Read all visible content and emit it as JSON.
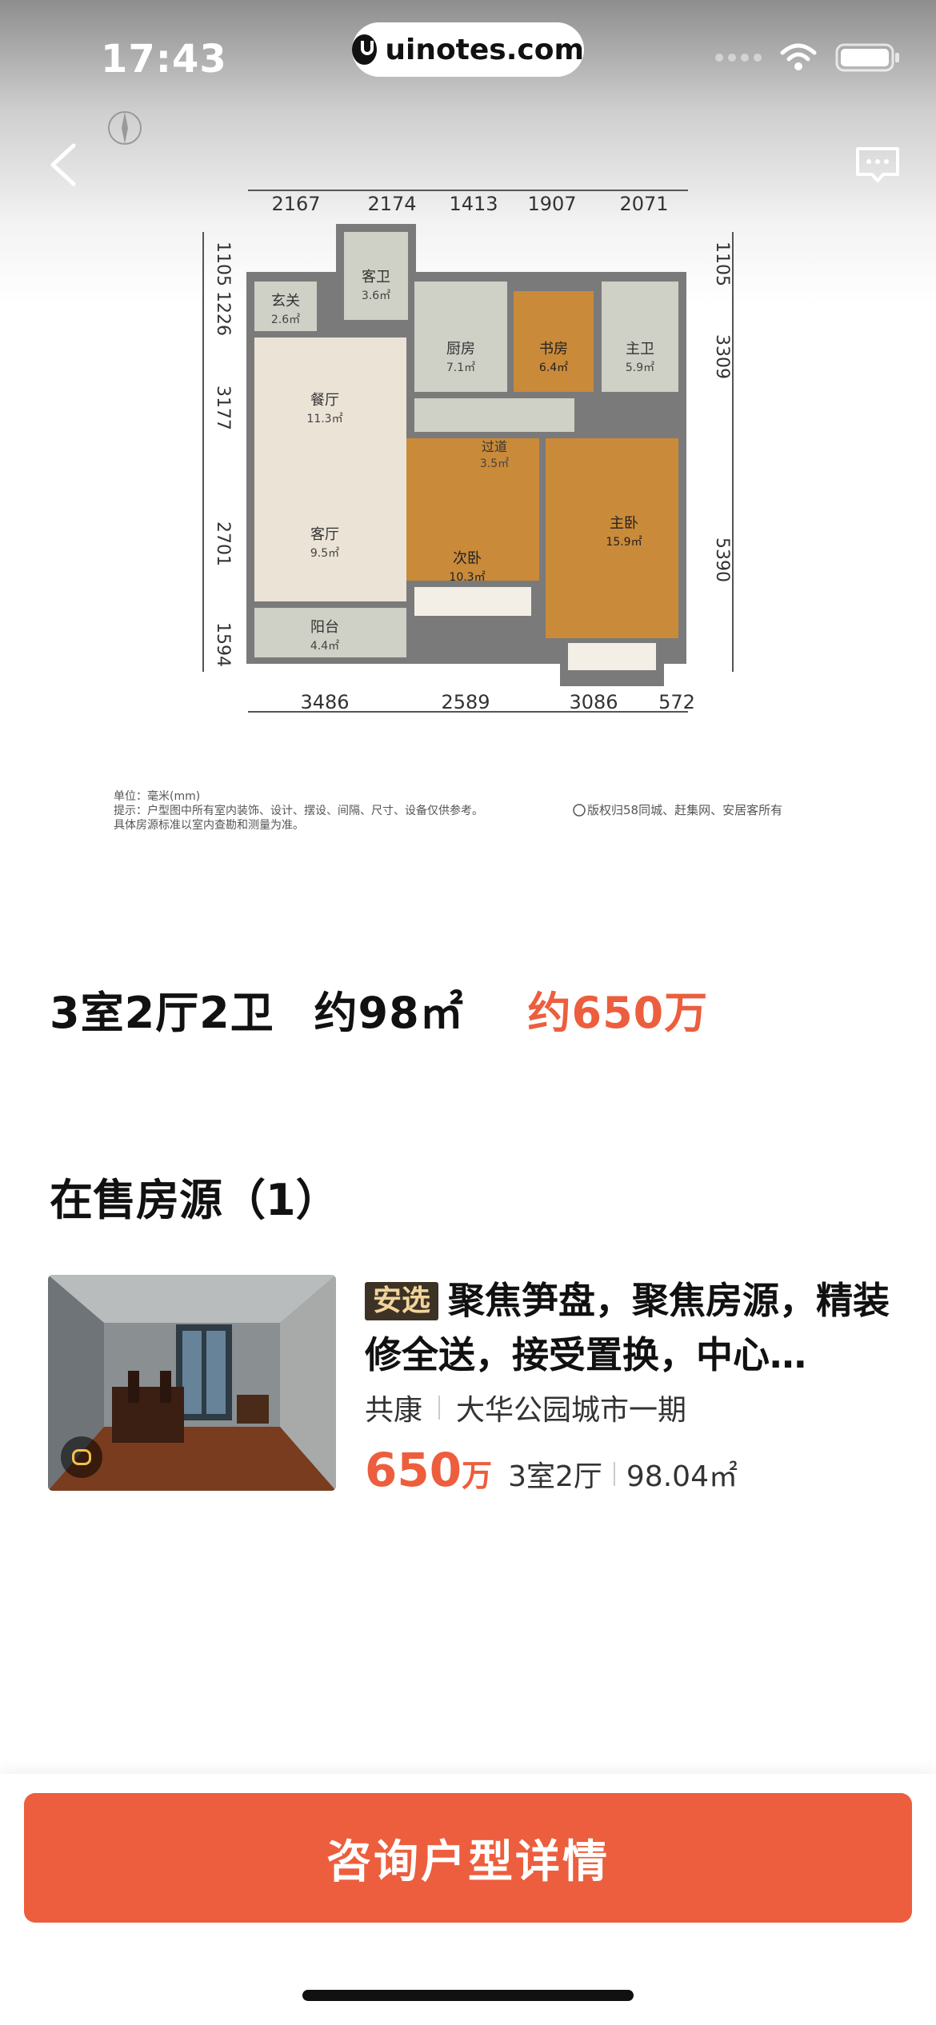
{
  "status": {
    "time": "17:43",
    "url": "uinotes.com"
  },
  "plan": {
    "dims_top": [
      "2167",
      "2174",
      "1413",
      "1907",
      "2071"
    ],
    "dims_bottom": [
      "3486",
      "2589",
      "3086",
      "572"
    ],
    "dims_left": [
      "1105",
      "1226",
      "3177",
      "2701",
      "1594"
    ],
    "dims_right": [
      "1105",
      "3309",
      "5390"
    ],
    "rooms": [
      {
        "name": "玄关",
        "area": "2.6㎡"
      },
      {
        "name": "客卫",
        "area": "3.6㎡"
      },
      {
        "name": "厨房",
        "area": "7.1㎡"
      },
      {
        "name": "书房",
        "area": "6.4㎡"
      },
      {
        "name": "主卫",
        "area": "5.9㎡"
      },
      {
        "name": "餐厅",
        "area": "11.3㎡"
      },
      {
        "name": "过道",
        "area": "3.5㎡"
      },
      {
        "name": "客厅",
        "area": "9.5㎡"
      },
      {
        "name": "次卧",
        "area": "10.3㎡"
      },
      {
        "name": "主卧",
        "area": "15.9㎡"
      },
      {
        "name": "阳台",
        "area": "4.4㎡"
      }
    ],
    "note_unit": "单位：毫米(mm)",
    "note_tip": "提示：户型图中所有室内装饰、设计、摆设、间隔、尺寸、设备仅供参考。",
    "note_tip2": "具体房源标准以室内查勘和测量为准。",
    "copyright": "版权归58同城、赶集网、安居客所有"
  },
  "summary": {
    "layout": "3室2厅2卫",
    "area": "约98㎡",
    "price": "约650万"
  },
  "section": {
    "title": "在售房源（1）"
  },
  "listing": {
    "tag": "安选",
    "title": "聚焦笋盘，聚焦房源，精装修全送，接受置换，中心…",
    "district": "共康",
    "community": "大华公园城市一期",
    "price": "650",
    "price_unit": "万",
    "layout": "3室2厅",
    "area": "98.04㎡"
  },
  "cta": {
    "label": "咨询户型详情"
  },
  "colors": {
    "accent": "#ec5e3d",
    "tag_bg": "#3c3226",
    "tag_text": "#f2d49a"
  },
  "icons": [
    "back-icon",
    "message-icon",
    "wifi-icon",
    "battery-icon",
    "compass-icon",
    "panorama-icon"
  ]
}
